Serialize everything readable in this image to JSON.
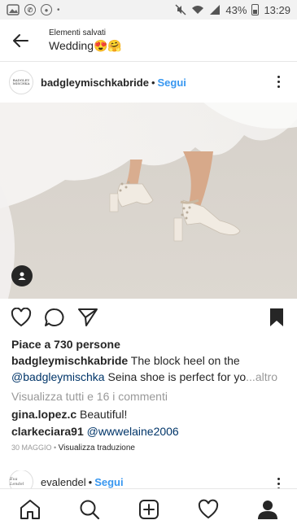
{
  "status_bar": {
    "battery": "43%",
    "time": "13:29"
  },
  "header": {
    "subtitle": "Elementi salvati",
    "title": "Wedding😍🤗"
  },
  "post": {
    "avatar_text": "BADGLEY MISCHKA",
    "username": "badgleymischkabride",
    "separator": "•",
    "follow_label": "Segui",
    "likes": "Piace a 730 persone",
    "caption_user": "badgleymischkabride",
    "caption_line1_text": " The block heel on the",
    "caption_mention": "@badgleymischka",
    "caption_line2_text": " Seina shoe is perfect for yo",
    "caption_more": "...altro",
    "view_comments": "Visualizza tutti e 16 i commenti",
    "comments": [
      {
        "user": "gina.lopez.c",
        "text": " Beautiful!"
      },
      {
        "user": "clarkeciara91",
        "text": " @wwwelaine2006"
      }
    ],
    "date": "30 MAGGIO",
    "date_sep": " • ",
    "translate": "Visualizza traduzione"
  },
  "next_post": {
    "avatar_text": "Eva Lendel",
    "username": "evalendel",
    "separator": "•",
    "follow_label": "Segui"
  },
  "icons": {
    "back": "arrow-left-icon",
    "more": "more-vertical-icon",
    "like": "heart-icon",
    "comment": "comment-icon",
    "share": "send-icon",
    "save": "bookmark-icon",
    "home": "home-icon",
    "search": "search-icon",
    "add": "add-post-icon",
    "activity": "heart-icon",
    "profile": "profile-icon"
  },
  "colors": {
    "accent": "#3897f0",
    "mention": "#003569",
    "muted": "#999999"
  }
}
